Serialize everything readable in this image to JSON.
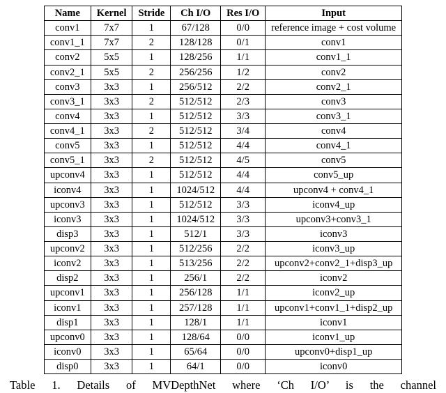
{
  "columns": [
    "Name",
    "Kernel",
    "Stride",
    "Ch I/O",
    "Res I/O",
    "Input"
  ],
  "rows": [
    {
      "name": "conv1",
      "kernel": "7x7",
      "stride": "1",
      "chio": "67/128",
      "resio": "0/0",
      "input": "reference image + cost volume"
    },
    {
      "name": "conv1_1",
      "kernel": "7x7",
      "stride": "2",
      "chio": "128/128",
      "resio": "0/1",
      "input": "conv1"
    },
    {
      "name": "conv2",
      "kernel": "5x5",
      "stride": "1",
      "chio": "128/256",
      "resio": "1/1",
      "input": "conv1_1"
    },
    {
      "name": "conv2_1",
      "kernel": "5x5",
      "stride": "2",
      "chio": "256/256",
      "resio": "1/2",
      "input": "conv2"
    },
    {
      "name": "conv3",
      "kernel": "3x3",
      "stride": "1",
      "chio": "256/512",
      "resio": "2/2",
      "input": "conv2_1"
    },
    {
      "name": "conv3_1",
      "kernel": "3x3",
      "stride": "2",
      "chio": "512/512",
      "resio": "2/3",
      "input": "conv3"
    },
    {
      "name": "conv4",
      "kernel": "3x3",
      "stride": "1",
      "chio": "512/512",
      "resio": "3/3",
      "input": "conv3_1"
    },
    {
      "name": "conv4_1",
      "kernel": "3x3",
      "stride": "2",
      "chio": "512/512",
      "resio": "3/4",
      "input": "conv4"
    },
    {
      "name": "conv5",
      "kernel": "3x3",
      "stride": "1",
      "chio": "512/512",
      "resio": "4/4",
      "input": "conv4_1"
    },
    {
      "name": "conv5_1",
      "kernel": "3x3",
      "stride": "2",
      "chio": "512/512",
      "resio": "4/5",
      "input": "conv5"
    },
    {
      "name": "upconv4",
      "kernel": "3x3",
      "stride": "1",
      "chio": "512/512",
      "resio": "4/4",
      "input": "conv5_up"
    },
    {
      "name": "iconv4",
      "kernel": "3x3",
      "stride": "1",
      "chio": "1024/512",
      "resio": "4/4",
      "input": "upconv4 + conv4_1"
    },
    {
      "name": "upconv3",
      "kernel": "3x3",
      "stride": "1",
      "chio": "512/512",
      "resio": "3/3",
      "input": "iconv4_up"
    },
    {
      "name": "iconv3",
      "kernel": "3x3",
      "stride": "1",
      "chio": "1024/512",
      "resio": "3/3",
      "input": "upconv3+conv3_1"
    },
    {
      "name": "disp3",
      "kernel": "3x3",
      "stride": "1",
      "chio": "512/1",
      "resio": "3/3",
      "input": "iconv3"
    },
    {
      "name": "upconv2",
      "kernel": "3x3",
      "stride": "1",
      "chio": "512/256",
      "resio": "2/2",
      "input": "iconv3_up"
    },
    {
      "name": "iconv2",
      "kernel": "3x3",
      "stride": "1",
      "chio": "513/256",
      "resio": "2/2",
      "input": "upconv2+conv2_1+disp3_up"
    },
    {
      "name": "disp2",
      "kernel": "3x3",
      "stride": "1",
      "chio": "256/1",
      "resio": "2/2",
      "input": "iconv2"
    },
    {
      "name": "upconv1",
      "kernel": "3x3",
      "stride": "1",
      "chio": "256/128",
      "resio": "1/1",
      "input": "iconv2_up"
    },
    {
      "name": "iconv1",
      "kernel": "3x3",
      "stride": "1",
      "chio": "257/128",
      "resio": "1/1",
      "input": "upconv1+conv1_1+disp2_up"
    },
    {
      "name": "disp1",
      "kernel": "3x3",
      "stride": "1",
      "chio": "128/1",
      "resio": "1/1",
      "input": "iconv1"
    },
    {
      "name": "upconv0",
      "kernel": "3x3",
      "stride": "1",
      "chio": "128/64",
      "resio": "0/0",
      "input": "iconv1_up"
    },
    {
      "name": "iconv0",
      "kernel": "3x3",
      "stride": "1",
      "chio": "65/64",
      "resio": "0/0",
      "input": "upconv0+disp1_up"
    },
    {
      "name": "disp0",
      "kernel": "3x3",
      "stride": "1",
      "chio": "64/1",
      "resio": "0/0",
      "input": "iconv0"
    }
  ],
  "caption": "Table 1. Details of MVDepthNet where ‘Ch I/O’ is the channel"
}
